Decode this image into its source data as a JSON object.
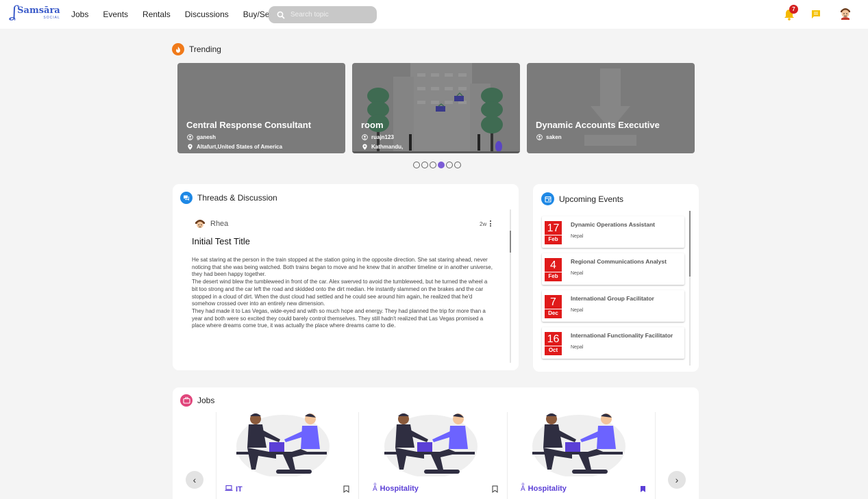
{
  "nav": {
    "logo_word": "Samsāra",
    "logo_sub": "SOCIAL",
    "links": [
      "Jobs",
      "Events",
      "Rentals",
      "Discussions",
      "Buy/Sell"
    ],
    "search_placeholder": "Search topic",
    "notification_count": "7",
    "accent": "#7c5cd6"
  },
  "trending": {
    "heading": "Trending",
    "cards": [
      {
        "title": "Central Response Consultant",
        "user": "ganesh",
        "location": "Altafurt,United States of America"
      },
      {
        "title": "room",
        "user": "ruajn123",
        "location": "Kathmandu,"
      },
      {
        "title": "Dynamic Accounts Executive",
        "user": "saken",
        "location": ""
      }
    ],
    "dots_total": 6,
    "dots_active": 4
  },
  "threads": {
    "heading": "Threads & Discussion",
    "post": {
      "author": "Rhea",
      "time": "2w",
      "title": "Initial Test Title",
      "paragraphs": [
        "He sat staring at the person in the train stopped at the station going in the opposite direction. She sat staring ahead, never noticing that she was being watched. Both trains began to move and he knew that in another timeline or in another universe, they had been happy together.",
        "The desert wind blew the tumbleweed in front of the car. Alex swerved to avoid the tumbleweed, but he turned the wheel a bit too strong and the car left the road and skidded onto the dirt median. He instantly slammed on the brakes and the car stopped in a cloud of dirt. When the dust cloud had settled and he could see around him again, he realized that he'd somehow crossed over into an entirely new dimension.",
        "They had made it to Las Vegas, wide-eyed and with so much hope and energy. They had planned the trip for more than a year and both were so excited they could barely control themselves. They still hadn't realized that Las Vegas promised a place where dreams come true, it was actually the place where dreams came to die."
      ]
    }
  },
  "events": {
    "heading": "Upcoming Events",
    "items": [
      {
        "day": "17",
        "month": "Feb",
        "title": "Dynamic Operations Assistant",
        "location": "Nepal"
      },
      {
        "day": "4",
        "month": "Feb",
        "title": "Regional Communications Analyst",
        "location": "Nepal"
      },
      {
        "day": "7",
        "month": "Dec",
        "title": "International Group Facilitator",
        "location": "Nepal"
      },
      {
        "day": "16",
        "month": "Oct",
        "title": "International Functionality Facilitator",
        "location": "Nepal"
      }
    ]
  },
  "jobs": {
    "heading": "Jobs",
    "items": [
      {
        "category": "IT",
        "icon": "laptop-icon",
        "bookmarked": false
      },
      {
        "category": "Hospitality",
        "icon": "translate-icon",
        "bookmarked": false
      },
      {
        "category": "Hospitality",
        "icon": "translate-icon",
        "bookmarked": true
      }
    ],
    "prev": "‹",
    "next": "›"
  }
}
